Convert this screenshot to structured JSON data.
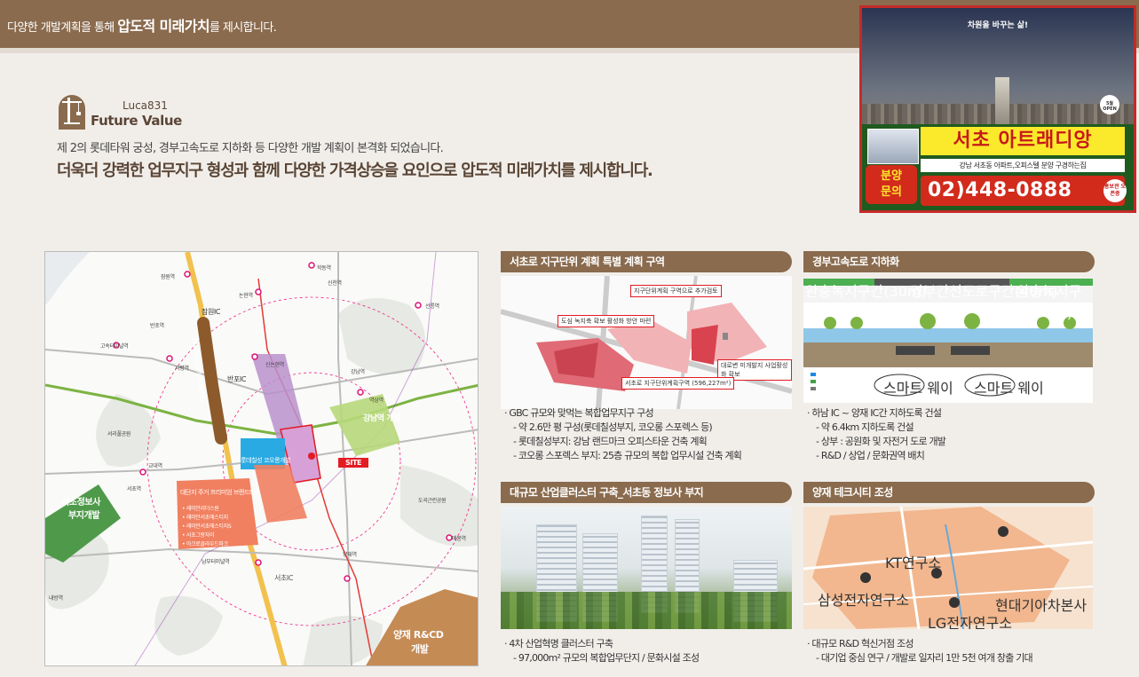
{
  "header": {
    "text_before": "다양한 개발계획을 통해 ",
    "text_bold": "압도적 미래가치",
    "text_after": "를 제시합니다."
  },
  "brand": {
    "small": "Luca831",
    "big": "Future Value"
  },
  "intro": {
    "line1": "제 2의 롯데타워 궁성, 경부고속도로 지하화 등 다양한 개발 계획이 본격화 되었습니다.",
    "line2": "더욱더 강력한 업무지구 형성과 함께 다양한 가격상승을 요인으로 압도적 미래가치를 제시합니다."
  },
  "ad": {
    "slogan": "차원을 바꾸는 삶!",
    "open": "5월 OPEN",
    "name": "서초 아트래디앙",
    "desc": "강남 서초동 아파트,오피스텔 분양 구경하는집",
    "inquiry_1": "분양",
    "inquiry_2": "문의",
    "phone": "02)448-0888",
    "seal": "홍보관 오픈중"
  },
  "map": {
    "labels": {
      "jamwon": "잠원역",
      "hakdong": "학동역",
      "nonhyeon": "논현역",
      "sinsa_line": "신분당선",
      "sinchon": "신천역",
      "seolleung": "선릉역",
      "jamwon_ic": "잠원IC",
      "banpo": "반포역",
      "express_terminal": "고속터미널역",
      "sapyeong": "사평역",
      "banpo_ic": "반포IC",
      "sinnonhyeon": "신논현역",
      "gangnam": "강남역",
      "yeoksam": "역삼역",
      "gyeongbu": "경부고속도로 지하화(계획)",
      "seoripul": "서리풀공원",
      "gyodae": "교대역",
      "seocho": "서초역",
      "lotte_chilsung": "롯데칠성 코오롱개발",
      "site": "SITE",
      "apt_title": "대단지 주거 프리미엄 브랜드타운",
      "apt_1": "• 래미안리더스원",
      "apt_2": "• 래미안서초에스티지",
      "apt_3": "• 래미안서초에스티지S",
      "apt_4": "• 서초그랑자이",
      "apt_5": "• 아크로클라우드파크",
      "yangjae": "양재역",
      "maebong": "매봉역",
      "nambu": "남부터미널역",
      "seocho_ic": "서초IC",
      "yangjae_rnd_1": "양재 R&CD",
      "yangjae_rnd_2": "개발",
      "seocho_info_1": "서초정보사",
      "seocho_info_2": "부지개발",
      "gangnam_dev": "강남역 개발",
      "dogok": "도곡근린공원",
      "naebang": "내방역"
    }
  },
  "panels": {
    "p1": {
      "title": "서초로 지구단위 계획 특별 계획 구역",
      "callout_1": "지구단위계획 구역으로 추가검토",
      "callout_2": "도심 녹지축 확보 활성화 방안 마련",
      "callout_3": "대로변 미개발지 사업활성화 확보",
      "callout_4": "서초로 지구단위계획구역 (596,227m²)",
      "b1": "· GBC 규모와 맞먹는 복합업무지구 구성",
      "b2": "- 약 2.6만 평 구성(롯데칠성부지, 코오롱 스포렉스 등)",
      "b3": "- 롯데칠성부지: 강남 랜드마크 오피스타운 건축 계획",
      "b4": "- 코오롱 스포렉스 부지: 25층 규모의 복합 업무시설 건축 계획"
    },
    "p2": {
      "title": "경부고속도로 지하화",
      "zone_left": "완충녹지구간(30m)",
      "zone_mid": "경부간선도로구간(40m)",
      "zone_right": "완충녹지구간(30m)",
      "tunnel_1": "스마트 웨이",
      "tunnel_2": "스마트 웨이",
      "b1": "· 하남 IC ~ 양재 IC간 지하도록 건설",
      "b2": "- 약 6.4km 지하도록 건설",
      "b3": "- 상부 : 공원화 및 자전거 도로 개발",
      "b4": "- R&D / 상업 / 문화권역 배치"
    },
    "p3": {
      "title": "대규모 산업클러스터 구축_서초동 정보사 부지",
      "b1": "· 4차 산업혁명 클러스터 구축",
      "b2": "- 97,000m² 규모의 복합업무단지 / 문화시설 조성"
    },
    "p4": {
      "title": "양재 테크시티 조성",
      "lbl_1": "KT연구소",
      "lbl_2": "LG전자연구소",
      "lbl_3": "삼성전자연구소",
      "lbl_4": "현대기아차본사",
      "b1": "· 대규모 R&D 혁신거점 조성",
      "b2": "- 대기업 중심 연구 / 개발로 일자리 1만 5천 여개 창출 기대"
    }
  },
  "colors": {
    "brand_brown": "#8a6b4e",
    "ad_yellow": "#fbe92b",
    "ad_red": "#d22b1c",
    "site_red": "#e31b23"
  }
}
